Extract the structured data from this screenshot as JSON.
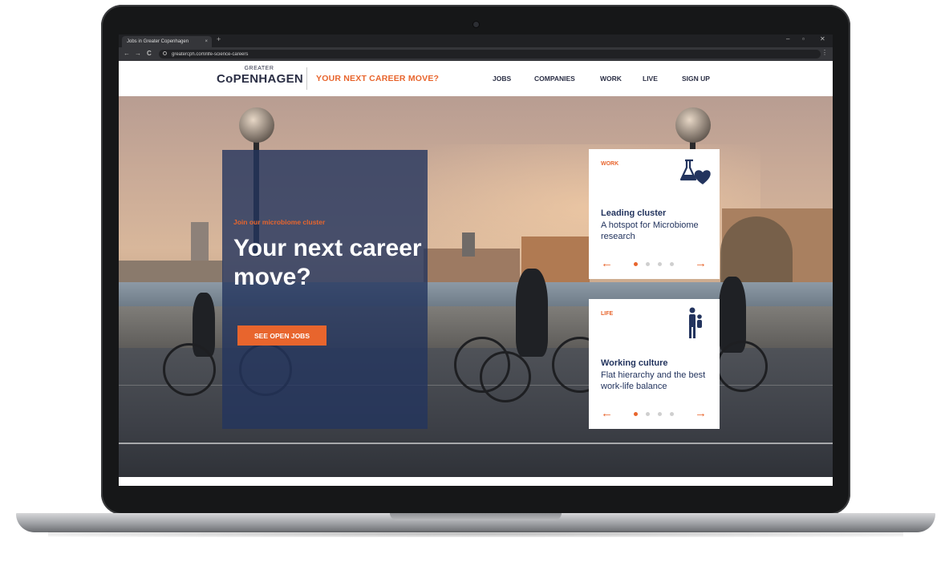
{
  "browser": {
    "tab_title": "Jobs in Greater Copenhagen",
    "tab_close": "×",
    "new_tab": "+",
    "url": "greatercph.com/life-science-careers",
    "back": "←",
    "forward": "→",
    "reload": "C",
    "menu": "⋮",
    "minimize": "–",
    "maximize": "▫",
    "close": "✕"
  },
  "header": {
    "logo_top": "GREATER",
    "logo_main": "CoPENHAGEN",
    "tagline": "YOUR NEXT CAREER MOVE?",
    "nav": [
      "JOBS",
      "COMPANIES",
      "WORK",
      "LIVE",
      "SIGN UP"
    ]
  },
  "hero": {
    "kicker": "Join our microbiome cluster",
    "title": "Your next career move?",
    "button_label": "SEE OPEN JOBS"
  },
  "cards": [
    {
      "category": "WORK",
      "icon": "flask-heart-icon",
      "title": "Leading cluster",
      "body": "A hotspot for Microbiome research",
      "prev": "←",
      "next": "→",
      "dots": 4,
      "active_dot": 0
    },
    {
      "category": "LIFE",
      "icon": "parent-child-icon",
      "title": "Working culture",
      "body": "Flat hierarchy and the best work-life balance",
      "prev": "←",
      "next": "→",
      "dots": 4,
      "active_dot": 0
    }
  ],
  "colors": {
    "accent": "#e8652d",
    "navy": "#23345e",
    "text_dark": "#2b2f45"
  }
}
